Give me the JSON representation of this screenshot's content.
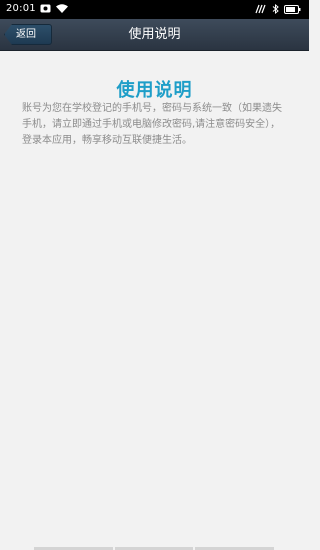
{
  "status_bar": {
    "time": "20:01",
    "left_icons": [
      "notification-icon",
      "wifi-icon"
    ],
    "right_icons": [
      "nfc-icon",
      "bluetooth-icon",
      "battery-icon"
    ]
  },
  "header": {
    "back_label": "返回",
    "title": "使用说明"
  },
  "main": {
    "heading": "使用说明",
    "body": "账号为您在学校登记的手机号，密码与系统一致（如果遗失手机，请立即通过手机或电脑修改密码,请注意密码安全），登录本应用，畅享移动互联便捷生活。"
  },
  "colors": {
    "status_bar": "#000000",
    "title_bar": "#354252",
    "accent": "#1e9ec8",
    "background": "#f2f2f2",
    "body_text": "#8c8c8c"
  }
}
